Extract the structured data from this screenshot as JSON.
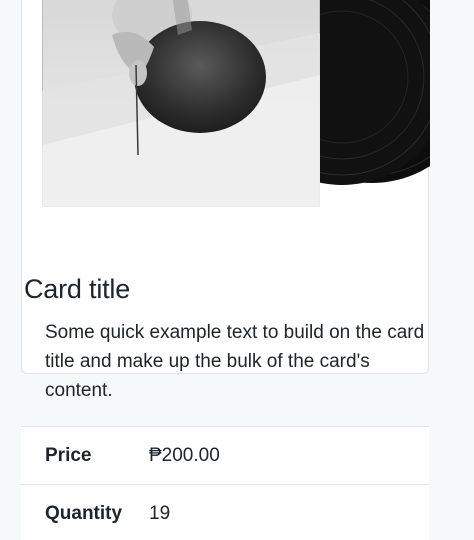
{
  "card": {
    "image_alt": "album-cover-with-vinyl-record",
    "title": "Card title",
    "text": "Some quick example text to build on the card title and make up the bulk of the card's content."
  },
  "details": [
    {
      "label": "Price",
      "value": "₱200.00"
    },
    {
      "label": "Quantity",
      "value": "19"
    }
  ]
}
